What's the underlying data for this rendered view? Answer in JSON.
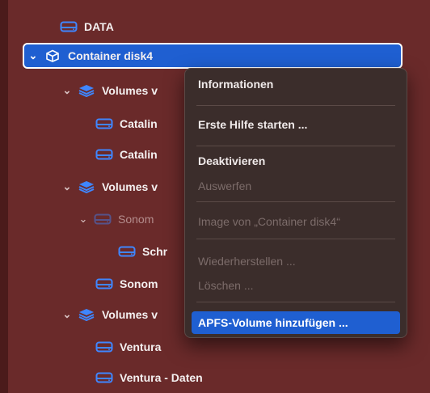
{
  "colors": {
    "accent": "#1f5fd1",
    "sidebar_bg": "#6a2a2a",
    "menu_bg": "#3b2d2b",
    "icon": "#3f86ff"
  },
  "sidebar": {
    "items": [
      {
        "label": "DATA",
        "icon": "drive-icon",
        "expanded": null
      },
      {
        "label": "Container disk4",
        "icon": "container-icon",
        "expanded": true,
        "selected": true
      },
      {
        "label": "Volumes v",
        "icon": "volume-stack-icon",
        "expanded": true
      },
      {
        "label": "Catalin",
        "icon": "drive-icon",
        "expanded": null
      },
      {
        "label": "Catalin",
        "icon": "drive-icon",
        "expanded": null
      },
      {
        "label": "Volumes v",
        "icon": "volume-stack-icon",
        "expanded": true
      },
      {
        "label": "Sonom",
        "icon": "drive-icon",
        "expanded": true,
        "dimmed": true
      },
      {
        "label": "Schr",
        "icon": "drive-icon",
        "expanded": null
      },
      {
        "label": "Sonom",
        "icon": "drive-icon",
        "expanded": null
      },
      {
        "label": "Volumes v",
        "icon": "volume-stack-icon",
        "expanded": true
      },
      {
        "label": "Ventura",
        "icon": "drive-icon",
        "expanded": null
      },
      {
        "label": "Ventura - Daten",
        "icon": "drive-icon",
        "expanded": null
      }
    ]
  },
  "context_menu": {
    "items": [
      {
        "label": "Informationen",
        "enabled": true
      },
      {
        "label": "Erste Hilfe starten ...",
        "enabled": true
      },
      {
        "label": "Deaktivieren",
        "enabled": true
      },
      {
        "label": "Auswerfen",
        "enabled": false
      },
      {
        "label": "Image von „Container disk4“",
        "enabled": false
      },
      {
        "label": "Wiederherstellen ...",
        "enabled": false
      },
      {
        "label": "Löschen ...",
        "enabled": false
      },
      {
        "label": "APFS-Volume hinzufügen ...",
        "enabled": true,
        "highlighted": true
      }
    ]
  }
}
